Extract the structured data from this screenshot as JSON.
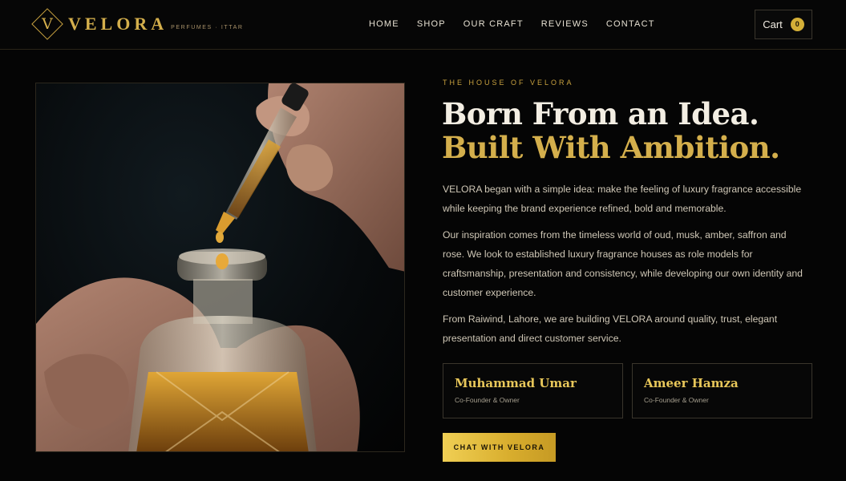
{
  "brand": {
    "logo_letter": "V",
    "name": "VELORA",
    "tagline": "PERFUMES · ITTAR"
  },
  "nav": {
    "items": [
      {
        "label": "HOME"
      },
      {
        "label": "SHOP"
      },
      {
        "label": "OUR CRAFT"
      },
      {
        "label": "REVIEWS"
      },
      {
        "label": "CONTACT"
      }
    ]
  },
  "cart": {
    "label": "Cart",
    "count": "0"
  },
  "hero_image": {
    "icon": "perfume-dropper-photo"
  },
  "about": {
    "eyebrow": "THE HOUSE OF VELORA",
    "headline_line1": "Born From an Idea.",
    "headline_line2": "Built With Ambition.",
    "paragraphs": [
      "VELORA began with a simple idea: make the feeling of luxury fragrance accessible while keeping the brand experience refined, bold and memorable.",
      "Our inspiration comes from the timeless world of oud, musk, amber, saffron and rose. We look to established luxury fragrance houses as role models for craftsmanship, presentation and consistency, while developing our own identity and customer experience.",
      "From Raiwind, Lahore, we are building VELORA around quality, trust, elegant presentation and direct customer service."
    ]
  },
  "founders": [
    {
      "name": "Muhammad Umar",
      "role": "Co-Founder & Owner"
    },
    {
      "name": "Ameer Hamza",
      "role": "Co-Founder & Owner"
    }
  ],
  "cta": {
    "label": "CHAT WITH VELORA"
  },
  "colors": {
    "background": "#050505",
    "gold": "#d4af4c",
    "text": "#cfc7b6"
  }
}
